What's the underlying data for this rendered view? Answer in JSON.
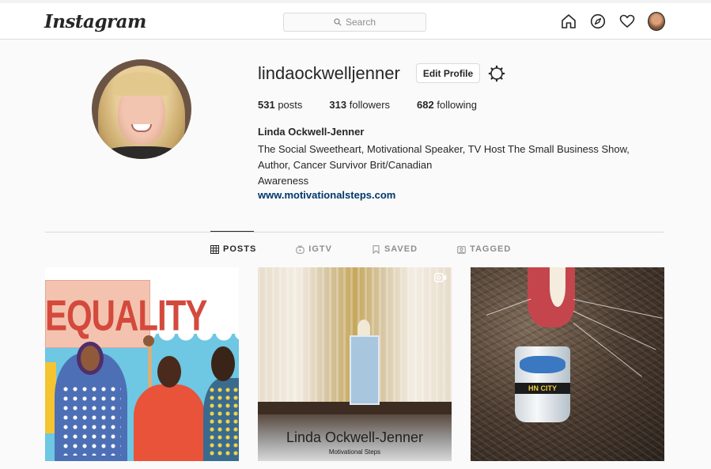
{
  "nav": {
    "logo": "Instagram",
    "search_placeholder": "Search",
    "icons": [
      "home-icon",
      "explore-icon",
      "heart-icon",
      "profile-avatar"
    ]
  },
  "profile": {
    "username": "lindaockwelljenner",
    "edit_label": "Edit Profile",
    "posts_count": "531",
    "posts_label": "posts",
    "followers_count": "313",
    "followers_label": "followers",
    "following_count": "682",
    "following_label": "following",
    "full_name": "Linda Ockwell-Jenner",
    "bio_lines": [
      "The Social Sweetheart, Motivational Speaker, TV Host The Small Business Show,",
      "Author, Cancer Survivor Brit/Canadian",
      "Awareness"
    ],
    "link": "www.motivationalsteps.com"
  },
  "tabs": [
    {
      "label": "POSTS",
      "active": true
    },
    {
      "label": "IGTV",
      "active": false
    },
    {
      "label": "SAVED",
      "active": false
    },
    {
      "label": "TAGGED",
      "active": false
    }
  ],
  "posts": [
    {
      "overlay_text": "EQUALITY"
    },
    {
      "caption": "Linda Ockwell-Jenner",
      "subcaption": "Motivational Steps"
    },
    {
      "cup_text": "HN CITY"
    }
  ],
  "colors": {
    "link": "#00376b",
    "border": "#dbdbdb",
    "text": "#262626",
    "muted": "#8e8e8e"
  }
}
